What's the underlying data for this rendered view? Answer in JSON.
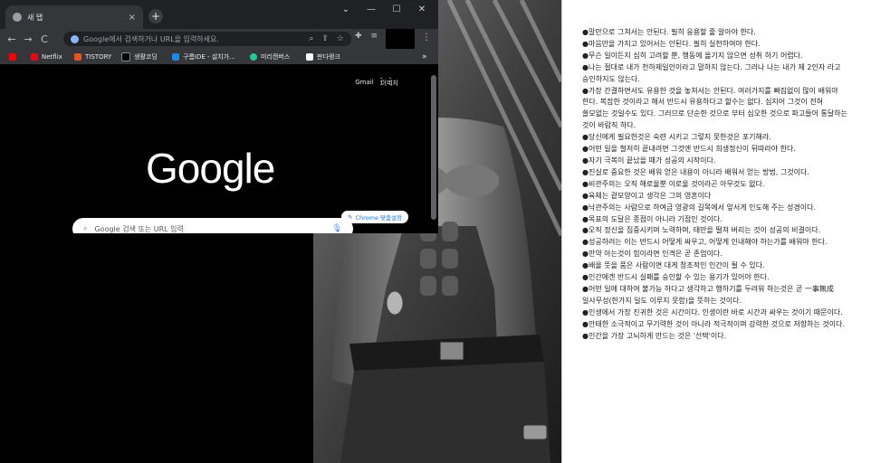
{
  "browser": {
    "tab_title": "새 탭",
    "tab_close": "×",
    "new_tab": "+",
    "window": {
      "minimize": "—",
      "maximize": "☐",
      "close": "✕",
      "dropdown": "⌄"
    },
    "nav": {
      "back": "←",
      "forward": "→",
      "reload": "C"
    },
    "omnibox_placeholder": "Google에서 검색하거나 URL을 입력하세요.",
    "menu": "⋮",
    "bookmarks": [
      {
        "label": "",
        "color": "#ff0000"
      },
      {
        "label": "Netflix",
        "color": "#e50914"
      },
      {
        "label": "TISTORY",
        "color": "#eb531f"
      },
      {
        "label": "생활코딩",
        "color": "#000000"
      },
      {
        "label": "구름IDE - 설치가...",
        "color": "#1e88e5"
      },
      {
        "label": "미리캔버스",
        "color": "#20c997"
      },
      {
        "label": "판다랭크",
        "color": "#ffffff"
      }
    ],
    "bookmarks_more": "»",
    "page": {
      "gmail": "Gmail",
      "images": "이미지",
      "logo": "Google",
      "search_placeholder": "Google 검색 또는 URL 입력",
      "customize": "Chrome 맞춤설정"
    }
  },
  "notes": [
    "●말만으로 그쳐서는 안된다. 필히 응용할 줄 알아야 한다.",
    "●마음만을 가지고 있어서는 안된다. 필히 실천하여야 한다.",
    "●무슨 일이든지 심히 고려할 뿐, 행동에 옮기지 않으면 성취 하기 어렵다.",
    "●나는 절대로 내가 천하제일인이라고 말하지 않는다. 그러나 나는 내가 제 2인자 라고 승인하지도 않는다.",
    "●가장 간결하면서도 유용한 것을 놓쳐서는 안된다. 여러가지를 빠짐없이 많이 배워야 한다. 복잡한 것이라고 해서 반드시 유용하다고 할수는 없다. 심지어 그것이 전혀",
    "쓸모없는 것일수도 있다. 그러므로 단순한 것으로 부터 심오한 것으로 파고들어 통달하는 것이 바람직 하다.",
    "●당신에게 필요한것은 숙련 시키고 그렇지 못한것은 포기해라.",
    "●어떤 일을 철저히 끝내려면 그것엔 반드시 희생정신이 뒤따라야 한다.",
    "●자기 극복이 끝났을 때가 성공의 시작이다.",
    "●진실로 중요한 것은 배워 얻은 내용이 아니라 배워서 얻는 방법, 그것이다.",
    "●비관주의는 오직 해로울뿐 이로울 것이라곤 아무것도 없다.",
    "●육체는 겉모양이고 생각은 그의 영혼이다",
    "●낙관주의는 사람으로 하여금 영광의 길목에서 앞서게 인도해 주는 성경이다.",
    "●목표의 도달은 종점이 아니라 기점인 것이다.",
    "●오직 정신을 집중시키며 노력하며, 태만을 떨쳐 버리는 것이 성공의 비결이다.",
    "●성공하려는 이는 반드시 어떻게 싸우고, 어떻게 인내해야 하는가를 배워야 한다.",
    "●만약 아는것이 힘이라면 인격은 곧 존엄이다.",
    "●배울 뜻을 품은 사람이면 대게 창조적인 인간이 될 수 있다.",
    "●인간에겐 반드시 실패를 승인할 수 있는 용기가 있어야 한다.",
    "●어떤 일에 대하여 불가능 하다고 생각하고 행하기를 두려워 하는것은 곧 一事無成",
    "일사무성(한가지 일도 이루지 못함)을 뜻하는 것이다.",
    "●인생에서 가장 진귀한 것은 시간이다. 인생이란 바로 시간과 싸우는 것이기 때문이다.",
    "●안태한 소극적이고 무기력한 것이 아니라 적극적이며 강력한 것으로 저항하는 것이다.",
    "●인간을 가장 고뇌하게 만드는 것은 '선택'이다."
  ]
}
